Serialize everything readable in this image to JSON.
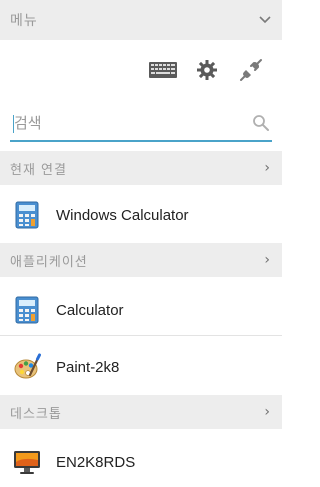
{
  "menu": {
    "title": "메뉴"
  },
  "search": {
    "placeholder": "검색"
  },
  "sections": {
    "current": "현재 연결",
    "apps": "애플리케이션",
    "desktops": "데스크톱"
  },
  "items": {
    "current_connection": "Windows Calculator",
    "calculator": "Calculator",
    "paint": "Paint-2k8",
    "desktop": "EN2K8RDS"
  },
  "icons": {
    "menu_toggle": "chevron-down-icon",
    "keyboard": "keyboard-icon",
    "settings": "gear-icon",
    "disconnect": "plug-icon",
    "search": "search-icon",
    "section_expand": "chevron-right-icon",
    "calculator": "calculator-icon",
    "paint": "paint-palette-icon",
    "desktop": "monitor-icon"
  },
  "colors": {
    "accent": "#4aa3c9",
    "header_bg": "#ededed",
    "muted_text": "#9a9a9a"
  }
}
